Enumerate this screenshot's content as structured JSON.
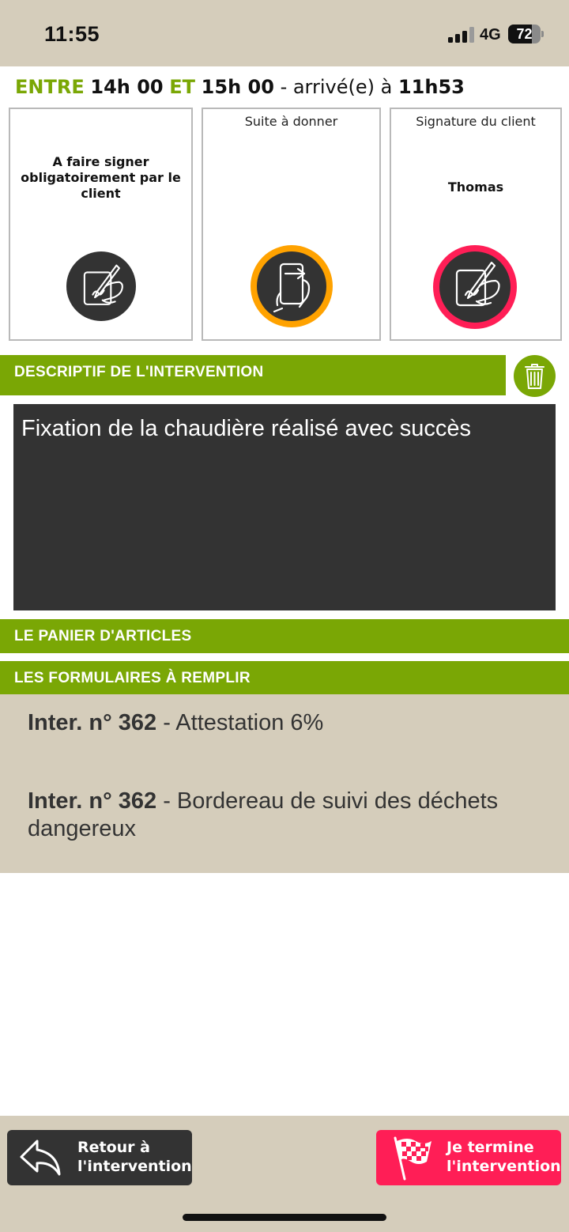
{
  "status_bar": {
    "time": "11:55",
    "network": "4G",
    "battery_level": "72",
    "battery_fraction": 0.72
  },
  "time_window": {
    "from_label": "ENTRE",
    "from_time": "14h 00",
    "to_label": "ET",
    "to_time": "15h 00",
    "arrival_prefix": "- arrivé(e) à",
    "arrival_time": "11h53"
  },
  "cards": [
    {
      "text": "A faire signer obligatoirement par le client",
      "icon": "hand-signing-icon",
      "ring_color": "#333333"
    },
    {
      "caption": "Suite à donner",
      "icon": "phone-transfer-icon",
      "ring_color": "#ffa200"
    },
    {
      "caption": "Signature du client",
      "text": "Thomas",
      "icon": "hand-signing-icon",
      "ring_color": "#ff1e56"
    }
  ],
  "sections": {
    "description_title": "DESCRIPTIF DE L'INTERVENTION",
    "description_text": "Fixation de la chaudière réalisé avec succès",
    "panier_title": "LE PANIER D'ARTICLES",
    "forms_title": "LES FORMULAIRES À REMPLIR"
  },
  "forms": [
    {
      "number": "Inter. n° 362",
      "label": "- Attestation 6%"
    },
    {
      "number": "Inter. n° 362",
      "label": "- Bordereau de suivi des déchets dangereux"
    }
  ],
  "buttons": {
    "back_line1": "Retour à",
    "back_line2": "l'intervention",
    "finish_line1": "Je termine",
    "finish_line2": "l'intervention"
  },
  "colors": {
    "accent_green": "#7aa705",
    "finish_red": "#ff1e56",
    "follow_orange": "#ffa200",
    "dark": "#333333",
    "beige": "#d5cdbb"
  }
}
